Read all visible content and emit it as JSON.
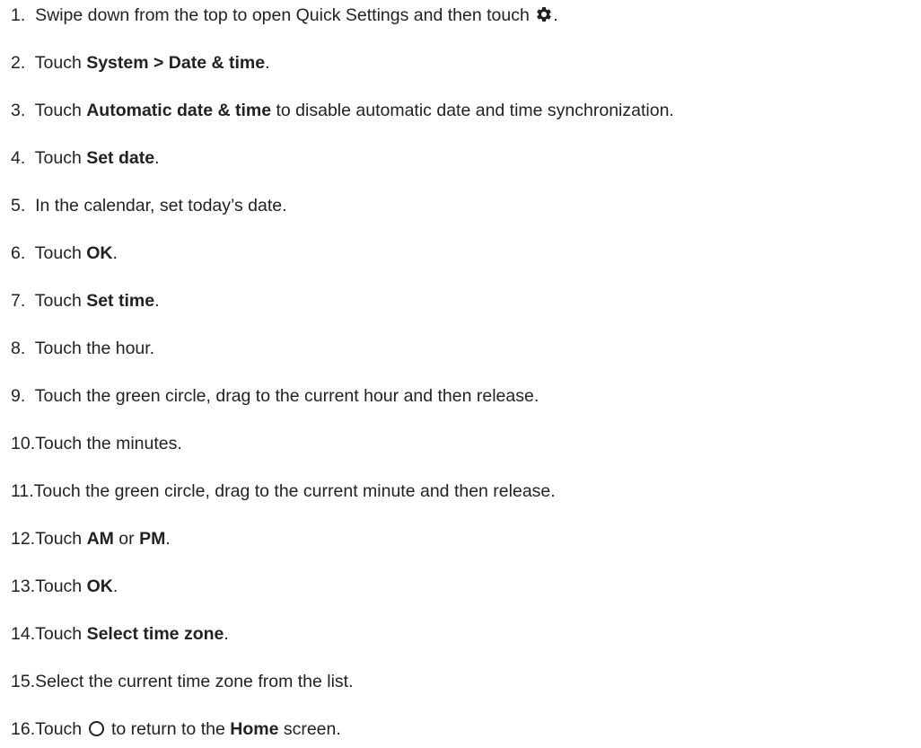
{
  "steps": [
    {
      "num": "1.",
      "pre": "Swipe down from the top to open Quick Settings and then touch ",
      "icon": "gear-icon",
      "post": "."
    },
    {
      "num": "2.",
      "pre": "Touch ",
      "bold": "System > Date & time",
      "post": "."
    },
    {
      "num": "3.",
      "pre": "Touch ",
      "bold": "Automatic date & time",
      "post": " to disable automatic date and time synchronization."
    },
    {
      "num": "4.",
      "pre": "Touch ",
      "bold": "Set date",
      "post": "."
    },
    {
      "num": "5.",
      "pre": "In the calendar, set today’s date."
    },
    {
      "num": "6.",
      "pre": "Touch ",
      "bold": "OK",
      "post": "."
    },
    {
      "num": "7.",
      "pre": "Touch ",
      "bold": "Set time",
      "post": "."
    },
    {
      "num": "8.",
      "pre": "Touch the hour."
    },
    {
      "num": "9.",
      "pre": "Touch the green circle, drag to the current hour and then release."
    },
    {
      "num": "10.",
      "pre": "Touch the minutes."
    },
    {
      "num": "11.",
      "pre": "Touch the green circle, drag to the current minute and then release."
    },
    {
      "num": "12.",
      "pre": "Touch ",
      "bold": "AM",
      "mid": " or ",
      "bold2": "PM",
      "post": "."
    },
    {
      "num": "13.",
      "pre": "Touch ",
      "bold": "OK",
      "post": "."
    },
    {
      "num": "14.",
      "pre": "Touch ",
      "bold": "Select time zone",
      "post": "."
    },
    {
      "num": "15.",
      "pre": "Select the current time zone from the list."
    },
    {
      "num": "16.",
      "pre": "Touch ",
      "icon": "home-circle-icon",
      "mid": " to return to the ",
      "bold": "Home",
      "post": " screen."
    }
  ]
}
